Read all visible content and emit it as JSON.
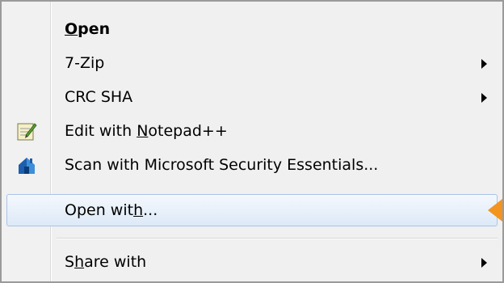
{
  "menu": {
    "items": [
      {
        "label_pre": "",
        "label_ul": "O",
        "label_post": "pen",
        "has_submenu": false,
        "bold": true,
        "icon": ""
      },
      {
        "label_pre": "7-Zip",
        "label_ul": "",
        "label_post": "",
        "has_submenu": true,
        "bold": false,
        "icon": ""
      },
      {
        "label_pre": "CRC SHA",
        "label_ul": "",
        "label_post": "",
        "has_submenu": true,
        "bold": false,
        "icon": ""
      },
      {
        "label_pre": "Edit with ",
        "label_ul": "N",
        "label_post": "otepad++",
        "has_submenu": false,
        "bold": false,
        "icon": "notepad-plus-plus-icon"
      },
      {
        "label_pre": "Scan with Microsoft Security Essentials...",
        "label_ul": "",
        "label_post": "",
        "has_submenu": false,
        "bold": false,
        "icon": "microsoft-security-essentials-icon"
      },
      {
        "label_pre": "Open wit",
        "label_ul": "h",
        "label_post": "...",
        "has_submenu": false,
        "bold": false,
        "icon": "",
        "highlighted": true
      },
      {
        "label_pre": "S",
        "label_ul": "h",
        "label_post": "are with",
        "has_submenu": true,
        "bold": false,
        "icon": ""
      }
    ]
  },
  "colors": {
    "menu_background": "#f0f0f0",
    "highlight_border": "#a9c3e8",
    "highlight_fill": "#dde9f7",
    "pointer": "#f2941f"
  }
}
